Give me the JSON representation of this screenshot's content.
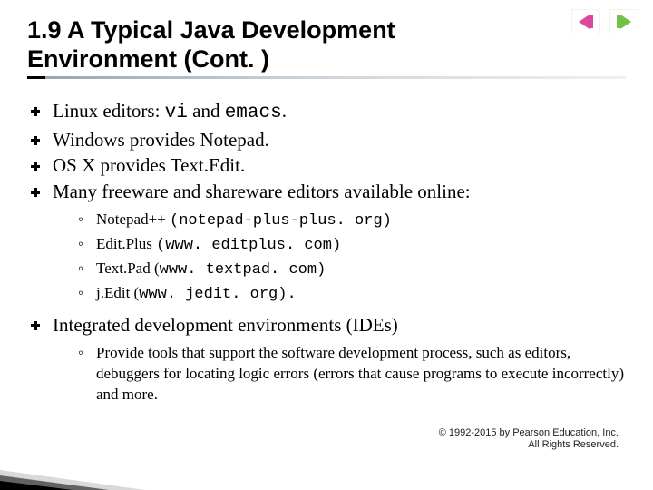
{
  "title": "1.9  A Typical Java Development Environment (Cont. )",
  "bullets": {
    "b1_pre": "Linux editors: ",
    "b1_code1": "vi",
    "b1_mid": " and ",
    "b1_code2": "emacs",
    "b1_post": ".",
    "b2": "Windows  provides Notepad.",
    "b3": "OS X provides Text.Edit.",
    "b4": "Many freeware and shareware editors available online:",
    "b5": "Integrated development environments (IDEs)"
  },
  "sub_editors": {
    "s1_name": "Notepad++ ",
    "s1_url": "(notepad-plus-plus. org)",
    "s2_name": "Edit.Plus ",
    "s2_url": "(www. editplus. com)",
    "s3_name": "Text.Pad (",
    "s3_url": "www. textpad. com)",
    "s4_name": "j.Edit (",
    "s4_url": "www. jedit. org).",
    "s4_post": ""
  },
  "sub_ide": {
    "s1": "Provide tools that support the software development process, such as editors, debuggers for locating logic errors (errors that cause programs to execute incorrectly) and more."
  },
  "copyright": {
    "line1": "© 1992-2015 by Pearson Education, Inc.",
    "line2": "All Rights Reserved."
  },
  "colors": {
    "nav_prev": "#d94a9e",
    "nav_next": "#6fc24a"
  }
}
